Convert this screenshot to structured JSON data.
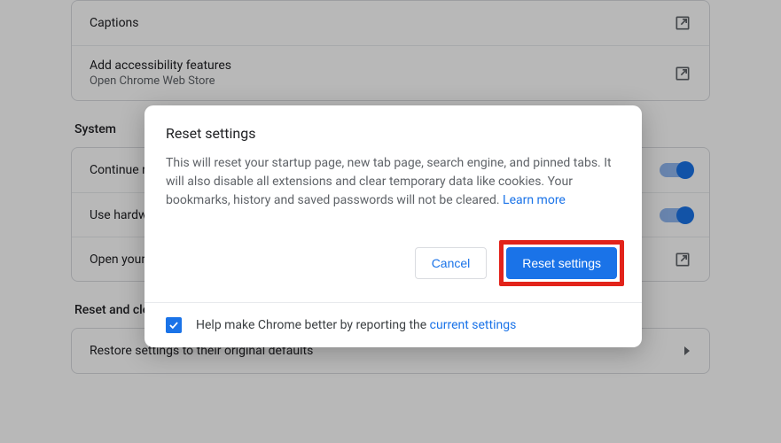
{
  "accessibility": {
    "row1_title": "Captions",
    "row2_title": "Add accessibility features",
    "row2_sub": "Open Chrome Web Store"
  },
  "system_section": {
    "heading": "System",
    "row1_title": "Continue running background apps when Google Chrome is closed",
    "row2_title": "Use hardware acceleration when available",
    "row3_title": "Open your computer's proxy settings"
  },
  "reset_section": {
    "heading": "Reset and clean up",
    "row1_title": "Restore settings to their original defaults"
  },
  "dialog": {
    "title": "Reset settings",
    "body_text": "This will reset your startup page, new tab page, search engine, and pinned tabs. It will also disable all extensions and clear temporary data like cookies. Your bookmarks, history and saved passwords will not be cleared. ",
    "learn_more": "Learn more",
    "cancel": "Cancel",
    "confirm": "Reset settings",
    "footer_prefix": "Help make Chrome better by reporting the ",
    "footer_link": "current settings"
  }
}
